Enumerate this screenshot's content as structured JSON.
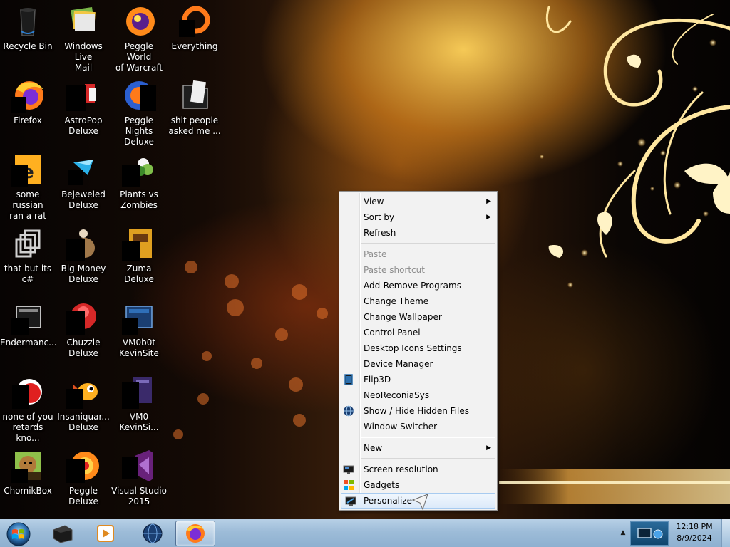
{
  "desktop": {
    "icons": [
      {
        "label": "Recycle Bin",
        "icon": "recycle-bin-icon"
      },
      {
        "label": "Windows Live\nMail",
        "icon": "windows-live-mail-icon"
      },
      {
        "label": "Peggle World\nof Warcraft ...",
        "icon": "peggle-world-of-warcraft-icon"
      },
      {
        "label": "Everything",
        "icon": "everything-search-icon"
      },
      {
        "label": "Firefox",
        "icon": "firefox-icon"
      },
      {
        "label": "AstroPop\nDeluxe",
        "icon": "astropop-deluxe-icon"
      },
      {
        "label": "Peggle Nights\nDeluxe",
        "icon": "peggle-nights-deluxe-icon"
      },
      {
        "label": "shit people\nasked me ...",
        "icon": "folder-icon"
      },
      {
        "label": "some russian\nran a rat",
        "icon": "file-shortcut-icon"
      },
      {
        "label": "Bejeweled\nDeluxe",
        "icon": "bejeweled-deluxe-icon"
      },
      {
        "label": "Plants vs\nZombies",
        "icon": "plants-vs-zombies-icon"
      },
      {
        "label": "that but its c#",
        "icon": "stacked-files-icon"
      },
      {
        "label": "Big Money\nDeluxe",
        "icon": "big-money-deluxe-icon"
      },
      {
        "label": "Zuma Deluxe",
        "icon": "zuma-deluxe-icon"
      },
      {
        "label": "Endermanc...",
        "icon": "monitor-shortcut-icon"
      },
      {
        "label": "Chuzzle\nDeluxe",
        "icon": "chuzzle-deluxe-icon"
      },
      {
        "label": "VM0b0t\nKevinSite",
        "icon": "vmware-icon"
      },
      {
        "label": "none of you\nretards kno...",
        "icon": "red-swirl-shortcut-icon"
      },
      {
        "label": "Insaniquar...\nDeluxe",
        "icon": "insaniquarium-deluxe-icon"
      },
      {
        "label": "VM0\nKevinSi...",
        "icon": "document-shortcut-icon"
      },
      {
        "label": "ChomikBox",
        "icon": "chomikbox-icon"
      },
      {
        "label": "Peggle Deluxe",
        "icon": "peggle-deluxe-icon"
      },
      {
        "label": "Visual Studio\n2015",
        "icon": "visual-studio-icon"
      }
    ]
  },
  "context_menu": {
    "items": [
      {
        "label": "View",
        "submenu": true
      },
      {
        "label": "Sort by",
        "submenu": true
      },
      {
        "label": "Refresh"
      },
      {
        "separator": true
      },
      {
        "label": "Paste",
        "disabled": true
      },
      {
        "label": "Paste shortcut",
        "disabled": true
      },
      {
        "label": "Add-Remove Programs"
      },
      {
        "label": "Change Theme"
      },
      {
        "label": "Change Wallpaper"
      },
      {
        "label": "Control Panel"
      },
      {
        "label": "Desktop Icons Settings"
      },
      {
        "label": "Device Manager"
      },
      {
        "label": "Flip3D",
        "icon": "flip3d-icon"
      },
      {
        "label": "NeoReconiaSys"
      },
      {
        "label": "Show / Hide Hidden Files",
        "icon": "globe-icon"
      },
      {
        "label": "Window Switcher"
      },
      {
        "separator": true
      },
      {
        "label": "New",
        "submenu": true
      },
      {
        "separator": true
      },
      {
        "label": "Screen resolution",
        "icon": "screen-resolution-icon"
      },
      {
        "label": "Gadgets",
        "icon": "gadgets-icon"
      },
      {
        "label": "Personalize",
        "icon": "personalize-icon",
        "hover": true
      }
    ]
  },
  "taskbar": {
    "pinned": [
      {
        "icon": "dark-app-icon"
      },
      {
        "icon": "media-player-icon"
      },
      {
        "icon": "globe-browser-icon"
      },
      {
        "icon": "firefox-icon",
        "active": true
      }
    ],
    "clock": {
      "time": "12:18 PM",
      "date": "8/9/2024"
    }
  },
  "colors": {
    "menu_bg": "#f2f2f2",
    "menu_hover": "#dceafa",
    "disabled_text": "#8d8d8d",
    "taskbar": "#9dbcd8"
  }
}
